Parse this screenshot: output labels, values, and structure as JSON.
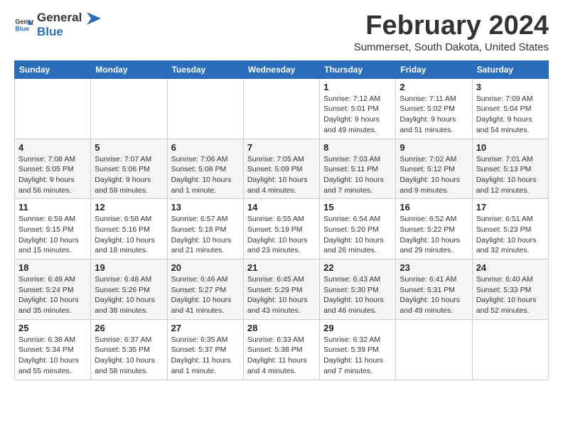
{
  "header": {
    "logo_general": "General",
    "logo_blue": "Blue",
    "month_title": "February 2024",
    "subtitle": "Summerset, South Dakota, United States"
  },
  "days_of_week": [
    "Sunday",
    "Monday",
    "Tuesday",
    "Wednesday",
    "Thursday",
    "Friday",
    "Saturday"
  ],
  "weeks": [
    [
      {
        "day": "",
        "info": ""
      },
      {
        "day": "",
        "info": ""
      },
      {
        "day": "",
        "info": ""
      },
      {
        "day": "",
        "info": ""
      },
      {
        "day": "1",
        "info": "Sunrise: 7:12 AM\nSunset: 5:01 PM\nDaylight: 9 hours and 49 minutes."
      },
      {
        "day": "2",
        "info": "Sunrise: 7:11 AM\nSunset: 5:02 PM\nDaylight: 9 hours and 51 minutes."
      },
      {
        "day": "3",
        "info": "Sunrise: 7:09 AM\nSunset: 5:04 PM\nDaylight: 9 hours and 54 minutes."
      }
    ],
    [
      {
        "day": "4",
        "info": "Sunrise: 7:08 AM\nSunset: 5:05 PM\nDaylight: 9 hours and 56 minutes."
      },
      {
        "day": "5",
        "info": "Sunrise: 7:07 AM\nSunset: 5:06 PM\nDaylight: 9 hours and 59 minutes."
      },
      {
        "day": "6",
        "info": "Sunrise: 7:06 AM\nSunset: 5:08 PM\nDaylight: 10 hours and 1 minute."
      },
      {
        "day": "7",
        "info": "Sunrise: 7:05 AM\nSunset: 5:09 PM\nDaylight: 10 hours and 4 minutes."
      },
      {
        "day": "8",
        "info": "Sunrise: 7:03 AM\nSunset: 5:11 PM\nDaylight: 10 hours and 7 minutes."
      },
      {
        "day": "9",
        "info": "Sunrise: 7:02 AM\nSunset: 5:12 PM\nDaylight: 10 hours and 9 minutes."
      },
      {
        "day": "10",
        "info": "Sunrise: 7:01 AM\nSunset: 5:13 PM\nDaylight: 10 hours and 12 minutes."
      }
    ],
    [
      {
        "day": "11",
        "info": "Sunrise: 6:59 AM\nSunset: 5:15 PM\nDaylight: 10 hours and 15 minutes."
      },
      {
        "day": "12",
        "info": "Sunrise: 6:58 AM\nSunset: 5:16 PM\nDaylight: 10 hours and 18 minutes."
      },
      {
        "day": "13",
        "info": "Sunrise: 6:57 AM\nSunset: 5:18 PM\nDaylight: 10 hours and 21 minutes."
      },
      {
        "day": "14",
        "info": "Sunrise: 6:55 AM\nSunset: 5:19 PM\nDaylight: 10 hours and 23 minutes."
      },
      {
        "day": "15",
        "info": "Sunrise: 6:54 AM\nSunset: 5:20 PM\nDaylight: 10 hours and 26 minutes."
      },
      {
        "day": "16",
        "info": "Sunrise: 6:52 AM\nSunset: 5:22 PM\nDaylight: 10 hours and 29 minutes."
      },
      {
        "day": "17",
        "info": "Sunrise: 6:51 AM\nSunset: 5:23 PM\nDaylight: 10 hours and 32 minutes."
      }
    ],
    [
      {
        "day": "18",
        "info": "Sunrise: 6:49 AM\nSunset: 5:24 PM\nDaylight: 10 hours and 35 minutes."
      },
      {
        "day": "19",
        "info": "Sunrise: 6:48 AM\nSunset: 5:26 PM\nDaylight: 10 hours and 38 minutes."
      },
      {
        "day": "20",
        "info": "Sunrise: 6:46 AM\nSunset: 5:27 PM\nDaylight: 10 hours and 41 minutes."
      },
      {
        "day": "21",
        "info": "Sunrise: 6:45 AM\nSunset: 5:29 PM\nDaylight: 10 hours and 43 minutes."
      },
      {
        "day": "22",
        "info": "Sunrise: 6:43 AM\nSunset: 5:30 PM\nDaylight: 10 hours and 46 minutes."
      },
      {
        "day": "23",
        "info": "Sunrise: 6:41 AM\nSunset: 5:31 PM\nDaylight: 10 hours and 49 minutes."
      },
      {
        "day": "24",
        "info": "Sunrise: 6:40 AM\nSunset: 5:33 PM\nDaylight: 10 hours and 52 minutes."
      }
    ],
    [
      {
        "day": "25",
        "info": "Sunrise: 6:38 AM\nSunset: 5:34 PM\nDaylight: 10 hours and 55 minutes."
      },
      {
        "day": "26",
        "info": "Sunrise: 6:37 AM\nSunset: 5:35 PM\nDaylight: 10 hours and 58 minutes."
      },
      {
        "day": "27",
        "info": "Sunrise: 6:35 AM\nSunset: 5:37 PM\nDaylight: 11 hours and 1 minute."
      },
      {
        "day": "28",
        "info": "Sunrise: 6:33 AM\nSunset: 5:38 PM\nDaylight: 11 hours and 4 minutes."
      },
      {
        "day": "29",
        "info": "Sunrise: 6:32 AM\nSunset: 5:39 PM\nDaylight: 11 hours and 7 minutes."
      },
      {
        "day": "",
        "info": ""
      },
      {
        "day": "",
        "info": ""
      }
    ]
  ]
}
